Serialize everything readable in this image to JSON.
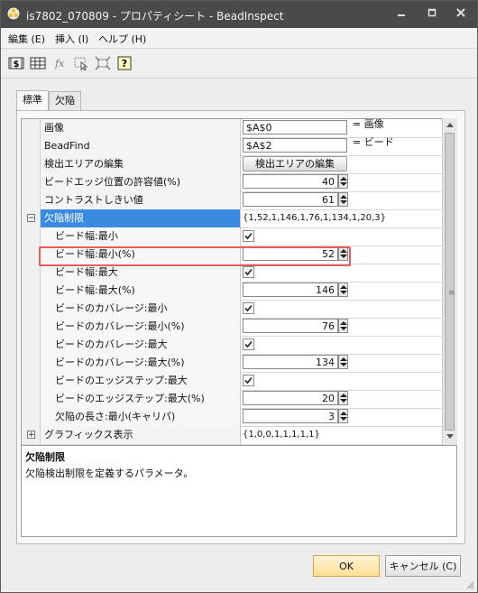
{
  "window": {
    "title": "is7802_070809 - プロパティシート - BeadInspect"
  },
  "menu": [
    "編集 (E)",
    "挿入 (I)",
    "ヘルプ (H)"
  ],
  "toolbar_icons": [
    "sheet-dollar-icon",
    "grid-icon",
    "function-icon",
    "select-cursor-icon",
    "fit-icon",
    "help-icon"
  ],
  "tabs": [
    "標準",
    "欠陥"
  ],
  "rows": [
    {
      "name": "画像",
      "type": "text",
      "value": "$A$0",
      "suffix": "= 画像",
      "child": false
    },
    {
      "name": "BeadFind",
      "type": "text",
      "value": "$A$2",
      "suffix": "= ビード",
      "child": false
    },
    {
      "name": "検出エリアの編集",
      "type": "button",
      "value": "検出エリアの編集",
      "child": false
    },
    {
      "name": "ビードエッジ位置の許容値(%)",
      "type": "number",
      "value": "40",
      "child": false
    },
    {
      "name": "コントラストしきい値",
      "type": "number",
      "value": "61",
      "child": false
    },
    {
      "name": "欠陥制限",
      "type": "plain",
      "value": "{1,52,1,146,1,76,1,134,1,20,3}",
      "child": false,
      "expander": "−",
      "selected": true
    },
    {
      "name": "ビード幅:最小",
      "type": "check",
      "child": true
    },
    {
      "name": "ビード幅:最小(%)",
      "type": "number",
      "value": "52",
      "child": true
    },
    {
      "name": "ビード幅:最大",
      "type": "check",
      "child": true
    },
    {
      "name": "ビード幅:最大(%)",
      "type": "number",
      "value": "146",
      "child": true
    },
    {
      "name": "ビードのカバレージ:最小",
      "type": "check",
      "child": true
    },
    {
      "name": "ビードのカバレージ:最小(%)",
      "type": "number",
      "value": "76",
      "child": true
    },
    {
      "name": "ビードのカバレージ:最大",
      "type": "check",
      "child": true
    },
    {
      "name": "ビードのカバレージ:最大(%)",
      "type": "number",
      "value": "134",
      "child": true
    },
    {
      "name": "ビードのエッジステップ:最大",
      "type": "check",
      "child": true
    },
    {
      "name": "ビードのエッジステップ:最大(%)",
      "type": "number",
      "value": "20",
      "child": true
    },
    {
      "name": "欠陥の長さ:最小(キャリパ)",
      "type": "number",
      "value": "3",
      "child": true
    },
    {
      "name": "グラフィックス表示",
      "type": "plain",
      "value": "{1,0,0,1,1,1,1,1}",
      "child": false,
      "expander": "+"
    }
  ],
  "description": {
    "title": "欠陥制限",
    "text": "欠陥検出制限を定義するパラメータ。"
  },
  "buttons": {
    "ok": "OK",
    "cancel": "キャンセル (C)"
  },
  "colors": {
    "titlebar": "#4a4a4a",
    "selected": "#3a8be0",
    "highlight": "#e85b5b",
    "ok_bg": "#ffdf94"
  }
}
